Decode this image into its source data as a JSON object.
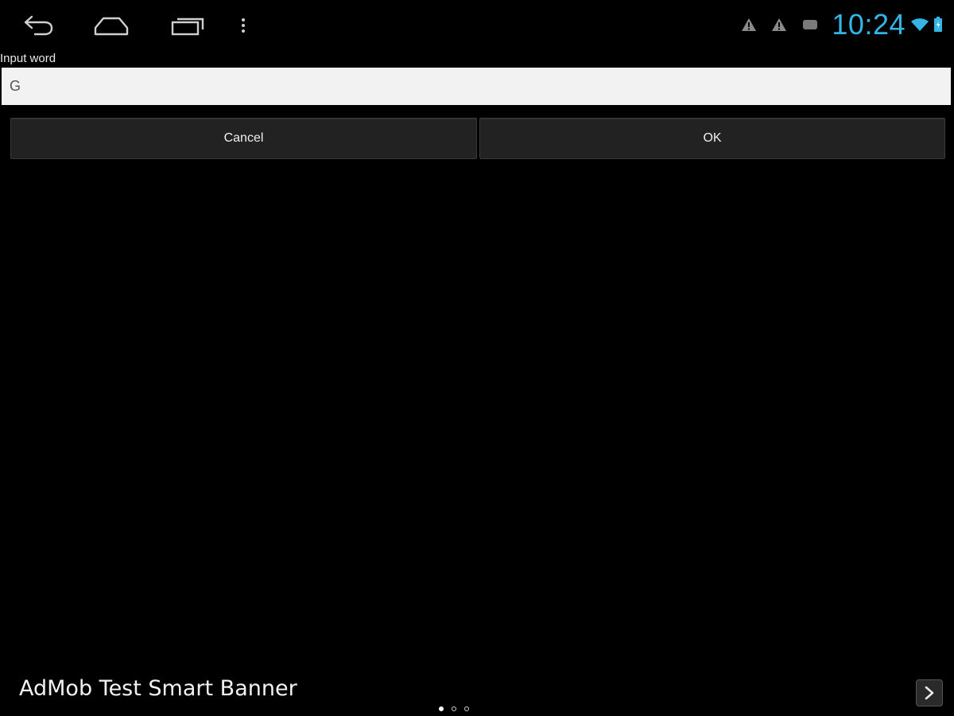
{
  "system_bar": {
    "nav": {
      "back_icon": "back-arrow-icon",
      "home_icon": "home-icon",
      "recents_icon": "recent-apps-icon",
      "menu_icon": "overflow-menu-icon"
    },
    "status": {
      "icons": [
        "warning-icon",
        "warning-icon",
        "message-icon",
        "wifi-icon",
        "battery-icon"
      ],
      "time": "10:24",
      "time_color": "#33b5e5"
    }
  },
  "dialog": {
    "label": "Input word",
    "input_value": "G",
    "cancel_label": "Cancel",
    "ok_label": "OK"
  },
  "ad_banner": {
    "text": "AdMob Test Smart Banner",
    "arrow_icon": "chevron-right-icon",
    "page_count": 3,
    "active_page": 1
  },
  "colors": {
    "background": "#000000",
    "accent": "#33b5e5",
    "input_background": "#f2f2f2",
    "button_background": "#222222"
  }
}
